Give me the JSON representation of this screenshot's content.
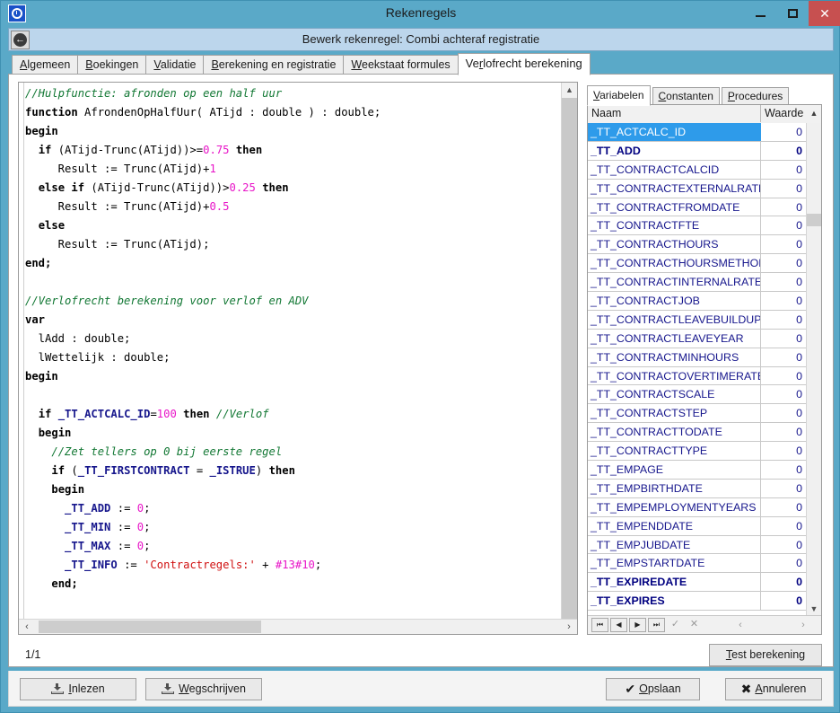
{
  "window": {
    "title": "Rekenregels",
    "app_icon": "clock-icon",
    "minimize_label": "–",
    "maximize_label": "□",
    "close_label": "✕"
  },
  "subheader": {
    "back_icon": "back-arrow-icon",
    "title": "Bewerk rekenregel: Combi achteraf registratie"
  },
  "tabs": [
    {
      "label": "Algemeen",
      "accel": "A",
      "active": false
    },
    {
      "label": "Boekingen",
      "accel": "B",
      "active": false
    },
    {
      "label": "Validatie",
      "accel": "V",
      "active": false
    },
    {
      "label": "Berekening en registratie",
      "accel": "B",
      "active": false
    },
    {
      "label": "Weekstaat formules",
      "accel": "W",
      "active": false
    },
    {
      "label": "Verlofrecht berekening",
      "accel": "r",
      "active": true
    }
  ],
  "editor": {
    "lines": [
      [
        [
          "cm",
          "//Hulpfunctie: afronden op een half uur"
        ]
      ],
      [
        [
          "kw",
          "function"
        ],
        [
          "pl",
          " AfrondenOpHalfUur( ATijd : double ) : double;"
        ]
      ],
      [
        [
          "kw",
          "begin"
        ]
      ],
      [
        [
          "pl",
          "  "
        ],
        [
          "kw",
          "if"
        ],
        [
          "pl",
          " (ATijd-Trunc(ATijd))>="
        ],
        [
          "num",
          "0.75"
        ],
        [
          "pl",
          " "
        ],
        [
          "kw",
          "then"
        ]
      ],
      [
        [
          "pl",
          "     Result := Trunc(ATijd)+"
        ],
        [
          "num",
          "1"
        ]
      ],
      [
        [
          "pl",
          "  "
        ],
        [
          "kw",
          "else if"
        ],
        [
          "pl",
          " (ATijd-Trunc(ATijd))>"
        ],
        [
          "num",
          "0.25"
        ],
        [
          "pl",
          " "
        ],
        [
          "kw",
          "then"
        ]
      ],
      [
        [
          "pl",
          "     Result := Trunc(ATijd)+"
        ],
        [
          "num",
          "0.5"
        ]
      ],
      [
        [
          "pl",
          "  "
        ],
        [
          "kw",
          "else"
        ]
      ],
      [
        [
          "pl",
          "     Result := Trunc(ATijd);"
        ]
      ],
      [
        [
          "kw",
          "end;"
        ]
      ],
      [
        [
          "pl",
          ""
        ]
      ],
      [
        [
          "cm",
          "//Verlofrecht berekening voor verlof en ADV"
        ]
      ],
      [
        [
          "kw",
          "var"
        ]
      ],
      [
        [
          "pl",
          "  lAdd : double;"
        ]
      ],
      [
        [
          "pl",
          "  lWettelijk : double;"
        ]
      ],
      [
        [
          "kw",
          "begin"
        ]
      ],
      [
        [
          "pl",
          ""
        ]
      ],
      [
        [
          "pl",
          "  "
        ],
        [
          "kw",
          "if"
        ],
        [
          "pl",
          " "
        ],
        [
          "var",
          "_TT_ACTCALC_ID"
        ],
        [
          "pl",
          "="
        ],
        [
          "num",
          "100"
        ],
        [
          "pl",
          " "
        ],
        [
          "kw",
          "then"
        ],
        [
          "pl",
          " "
        ],
        [
          "cm",
          "//Verlof"
        ]
      ],
      [
        [
          "pl",
          "  "
        ],
        [
          "kw",
          "begin"
        ]
      ],
      [
        [
          "pl",
          "    "
        ],
        [
          "cm",
          "//Zet tellers op 0 bij eerste regel"
        ]
      ],
      [
        [
          "pl",
          "    "
        ],
        [
          "kw",
          "if"
        ],
        [
          "pl",
          " ("
        ],
        [
          "var",
          "_TT_FIRSTCONTRACT"
        ],
        [
          "pl",
          " = "
        ],
        [
          "var",
          "_ISTRUE"
        ],
        [
          "pl",
          ") "
        ],
        [
          "kw",
          "then"
        ]
      ],
      [
        [
          "pl",
          "    "
        ],
        [
          "kw",
          "begin"
        ]
      ],
      [
        [
          "pl",
          "      "
        ],
        [
          "var",
          "_TT_ADD"
        ],
        [
          "pl",
          " := "
        ],
        [
          "num",
          "0"
        ],
        [
          "pl",
          ";"
        ]
      ],
      [
        [
          "pl",
          "      "
        ],
        [
          "var",
          "_TT_MIN"
        ],
        [
          "pl",
          " := "
        ],
        [
          "num",
          "0"
        ],
        [
          "pl",
          ";"
        ]
      ],
      [
        [
          "pl",
          "      "
        ],
        [
          "var",
          "_TT_MAX"
        ],
        [
          "pl",
          " := "
        ],
        [
          "num",
          "0"
        ],
        [
          "pl",
          ";"
        ]
      ],
      [
        [
          "pl",
          "      "
        ],
        [
          "var",
          "_TT_INFO"
        ],
        [
          "pl",
          " := "
        ],
        [
          "str",
          "'Contractregels:'"
        ],
        [
          "pl",
          " + "
        ],
        [
          "chr",
          "#13#10"
        ],
        [
          "pl",
          ";"
        ]
      ],
      [
        [
          "pl",
          "    "
        ],
        [
          "kw",
          "end;"
        ]
      ]
    ],
    "vscroll_up_icon": "chevron-up-icon",
    "hscroll_left_icon": "chevron-left-icon",
    "hscroll_right_icon": "chevron-right-icon"
  },
  "right_panel": {
    "tabs": [
      {
        "label": "Variabelen",
        "accel": "V",
        "active": true
      },
      {
        "label": "Constanten",
        "accel": "C",
        "active": false
      },
      {
        "label": "Procedures",
        "accel": "P",
        "active": false
      }
    ],
    "grid": {
      "columns": [
        "Naam",
        "Waarde"
      ],
      "rows": [
        {
          "name": "_TT_ACTCALC_ID",
          "value": "0",
          "selected": true,
          "bold": false
        },
        {
          "name": "_TT_ADD",
          "value": "0",
          "selected": false,
          "bold": true
        },
        {
          "name": "_TT_CONTRACTCALCID",
          "value": "0",
          "selected": false,
          "bold": false
        },
        {
          "name": "_TT_CONTRACTEXTERNALRATE",
          "value": "0",
          "selected": false,
          "bold": false
        },
        {
          "name": "_TT_CONTRACTFROMDATE",
          "value": "0",
          "selected": false,
          "bold": false
        },
        {
          "name": "_TT_CONTRACTFTE",
          "value": "0",
          "selected": false,
          "bold": false
        },
        {
          "name": "_TT_CONTRACTHOURS",
          "value": "0",
          "selected": false,
          "bold": false
        },
        {
          "name": "_TT_CONTRACTHOURSMETHOD",
          "value": "0",
          "selected": false,
          "bold": false
        },
        {
          "name": "_TT_CONTRACTINTERNALRATE",
          "value": "0",
          "selected": false,
          "bold": false
        },
        {
          "name": "_TT_CONTRACTJOB",
          "value": "0",
          "selected": false,
          "bold": false
        },
        {
          "name": "_TT_CONTRACTLEAVEBUILDUP",
          "value": "0",
          "selected": false,
          "bold": false
        },
        {
          "name": "_TT_CONTRACTLEAVEYEAR",
          "value": "0",
          "selected": false,
          "bold": false
        },
        {
          "name": "_TT_CONTRACTMINHOURS",
          "value": "0",
          "selected": false,
          "bold": false
        },
        {
          "name": "_TT_CONTRACTOVERTIMERATE",
          "value": "0",
          "selected": false,
          "bold": false
        },
        {
          "name": "_TT_CONTRACTSCALE",
          "value": "0",
          "selected": false,
          "bold": false
        },
        {
          "name": "_TT_CONTRACTSTEP",
          "value": "0",
          "selected": false,
          "bold": false
        },
        {
          "name": "_TT_CONTRACTTODATE",
          "value": "0",
          "selected": false,
          "bold": false
        },
        {
          "name": "_TT_CONTRACTTYPE",
          "value": "0",
          "selected": false,
          "bold": false
        },
        {
          "name": "_TT_EMPAGE",
          "value": "0",
          "selected": false,
          "bold": false
        },
        {
          "name": "_TT_EMPBIRTHDATE",
          "value": "0",
          "selected": false,
          "bold": false
        },
        {
          "name": "_TT_EMPEMPLOYMENTYEARS",
          "value": "0",
          "selected": false,
          "bold": false
        },
        {
          "name": "_TT_EMPENDDATE",
          "value": "0",
          "selected": false,
          "bold": false
        },
        {
          "name": "_TT_EMPJUBDATE",
          "value": "0",
          "selected": false,
          "bold": false
        },
        {
          "name": "_TT_EMPSTARTDATE",
          "value": "0",
          "selected": false,
          "bold": false
        },
        {
          "name": "_TT_EXPIREDATE",
          "value": "0",
          "selected": false,
          "bold": true
        },
        {
          "name": "_TT_EXPIRES",
          "value": "0",
          "selected": false,
          "bold": true
        }
      ]
    },
    "navigator": {
      "first": "⏮",
      "prior": "◀",
      "next": "▶",
      "last": "⏭",
      "post": "✓",
      "cancel": "✕",
      "scroll_left": "‹",
      "scroll_right": "›"
    }
  },
  "status": {
    "page_indicator": "1/1",
    "test_button": "Test berekening",
    "test_button_accel": "T"
  },
  "footer": {
    "inlezen": "Inlezen",
    "inlezen_accel": "I",
    "wegschrijven": "Wegschrijven",
    "wegschrijven_accel": "W",
    "opslaan": "Opslaan",
    "opslaan_accel": "O",
    "opslaan_icon": "check-icon",
    "annuleren": "Annuleren",
    "annuleren_accel": "A",
    "annuleren_icon": "close-icon"
  },
  "colors": {
    "titlebar": "#5aa9c8",
    "subheader": "#bcd6ec",
    "close_button": "#c75050",
    "selection": "#2e9bea",
    "variable_text": "#16168c",
    "comment": "#117733",
    "number": "#e815c8",
    "string": "#d01010"
  }
}
